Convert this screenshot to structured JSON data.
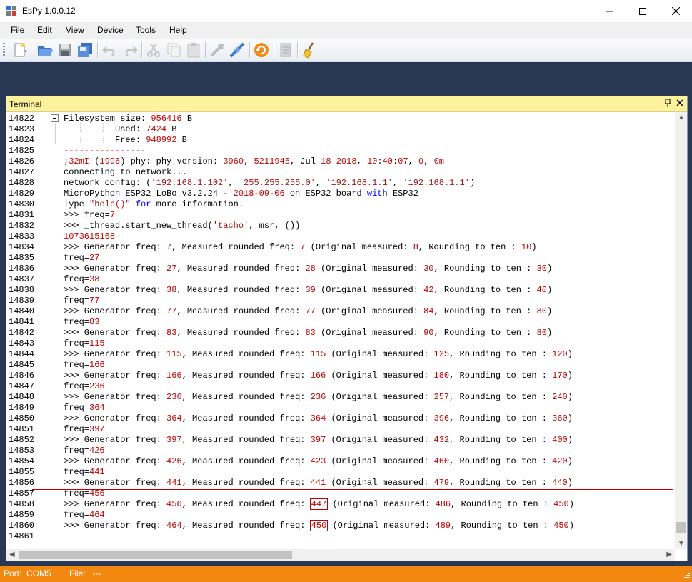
{
  "window": {
    "title": "EsPy 1.0.0.12",
    "minimize": "—",
    "maximize": "☐",
    "close": "✕"
  },
  "menu": [
    "File",
    "Edit",
    "View",
    "Device",
    "Tools",
    "Help"
  ],
  "toolbar_icons": [
    "new-file-icon",
    "open-folder-icon",
    "save-icon",
    "save-all-icon",
    "undo-icon",
    "redo-icon",
    "cut-icon",
    "copy-icon",
    "paste-icon",
    "disconnect-icon",
    "connect-icon",
    "refresh-icon",
    "document-icon",
    "broom-icon"
  ],
  "terminal": {
    "title": "Terminal",
    "pin": "📌",
    "close": "✕",
    "lines": [
      {
        "n": "14822",
        "h": "Filesystem size: <span class='n'>956416</span> B"
      },
      {
        "n": "14823",
        "h": "          Used: <span class='n'>7424</span> B"
      },
      {
        "n": "14824",
        "h": "          Free: <span class='n'>948992</span> B"
      },
      {
        "n": "14825",
        "h": "<span class='n'>----------------</span>"
      },
      {
        "n": "14826",
        "h": "<span class='n'>;32mI</span> (<span class='n'>1996</span>) phy: phy_version: <span class='n'>3960</span>, <span class='n'>5211945</span>, Jul <span class='n'>18 2018</span>, <span class='n'>10</span>:<span class='n'>40</span>:<span class='n'>07</span>, <span class='n'>0</span>, <span class='n'>0m</span>"
      },
      {
        "n": "14827",
        "h": "connecting to network..."
      },
      {
        "n": "14828",
        "h": "network config: (<span class='s'>'192.168.1.102'</span>, <span class='s'>'255.255.255.0'</span>, <span class='s'>'192.168.1.1'</span>, <span class='s'>'192.168.1.1'</span>)"
      },
      {
        "n": "14829",
        "h": "MicroPython ESP32_LoBo_v3.2.24 - <span class='n'>2018-09-06</span> on ESP32 board <span class='kw'>with</span> ESP32"
      },
      {
        "n": "14830",
        "h": "Type <span class='s'>\"help()\"</span> <span class='kw'>for</span> more information."
      },
      {
        "n": "14831",
        "h": ">>> freq=<span class='n'>7</span>"
      },
      {
        "n": "14832",
        "h": ">>> _thread.start_new_thread(<span class='s'>'tacho'</span>, msr, ())"
      },
      {
        "n": "14833",
        "h": "<span class='n'>1073615168</span>"
      },
      {
        "n": "14834",
        "h": ">>> Generator freq: <span class='n'>7</span>, Measured rounded freq: <span class='n'>7</span> (Original measured: <span class='n'>8</span>, Rounding to ten : <span class='n'>10</span>)"
      },
      {
        "n": "14835",
        "h": "freq=<span class='n'>27</span>"
      },
      {
        "n": "14836",
        "h": ">>> Generator freq: <span class='n'>27</span>, Measured rounded freq: <span class='n'>28</span> (Original measured: <span class='n'>30</span>, Rounding to ten : <span class='n'>30</span>)"
      },
      {
        "n": "14837",
        "h": "freq=<span class='n'>38</span>"
      },
      {
        "n": "14838",
        "h": ">>> Generator freq: <span class='n'>38</span>, Measured rounded freq: <span class='n'>39</span> (Original measured: <span class='n'>42</span>, Rounding to ten : <span class='n'>40</span>)"
      },
      {
        "n": "14839",
        "h": "freq=<span class='n'>77</span>"
      },
      {
        "n": "14840",
        "h": ">>> Generator freq: <span class='n'>77</span>, Measured rounded freq: <span class='n'>77</span> (Original measured: <span class='n'>84</span>, Rounding to ten : <span class='n'>80</span>)"
      },
      {
        "n": "14841",
        "h": "freq=<span class='n'>83</span>"
      },
      {
        "n": "14842",
        "h": ">>> Generator freq: <span class='n'>83</span>, Measured rounded freq: <span class='n'>83</span> (Original measured: <span class='n'>90</span>, Rounding to ten : <span class='n'>80</span>)"
      },
      {
        "n": "14843",
        "h": "freq=<span class='n'>115</span>"
      },
      {
        "n": "14844",
        "h": ">>> Generator freq: <span class='n'>115</span>, Measured rounded freq: <span class='n'>115</span> (Original measured: <span class='n'>125</span>, Rounding to ten : <span class='n'>120</span>)"
      },
      {
        "n": "14845",
        "h": "freq=<span class='n'>166</span>"
      },
      {
        "n": "14846",
        "h": ">>> Generator freq: <span class='n'>166</span>, Measured rounded freq: <span class='n'>166</span> (Original measured: <span class='n'>180</span>, Rounding to ten : <span class='n'>170</span>)"
      },
      {
        "n": "14847",
        "h": "freq=<span class='n'>236</span>"
      },
      {
        "n": "14848",
        "h": ">>> Generator freq: <span class='n'>236</span>, Measured rounded freq: <span class='n'>236</span> (Original measured: <span class='n'>257</span>, Rounding to ten : <span class='n'>240</span>)"
      },
      {
        "n": "14849",
        "h": "freq=<span class='n'>364</span>"
      },
      {
        "n": "14850",
        "h": ">>> Generator freq: <span class='n'>364</span>, Measured rounded freq: <span class='n'>364</span> (Original measured: <span class='n'>396</span>, Rounding to ten : <span class='n'>360</span>)"
      },
      {
        "n": "14851",
        "h": "freq=<span class='n'>397</span>"
      },
      {
        "n": "14852",
        "h": ">>> Generator freq: <span class='n'>397</span>, Measured rounded freq: <span class='n'>397</span> (Original measured: <span class='n'>432</span>, Rounding to ten : <span class='n'>400</span>)"
      },
      {
        "n": "14853",
        "h": "freq=<span class='n'>426</span>"
      },
      {
        "n": "14854",
        "h": ">>> Generator freq: <span class='n'>426</span>, Measured rounded freq: <span class='n'>423</span> (Original measured: <span class='n'>460</span>, Rounding to ten : <span class='n'>420</span>)"
      },
      {
        "n": "14855",
        "h": "freq=<span class='n'>441</span>"
      },
      {
        "n": "14856",
        "h": ">>> Generator freq: <span class='n'>441</span>, Measured rounded freq: <span class='n'>441</span> (Original measured: <span class='n'>479</span>, Rounding to ten : <span class='n'>440</span>)"
      },
      {
        "n": "14857",
        "h": "freq=<span class='n'>456</span>"
      },
      {
        "n": "14858",
        "h": ">>> Generator freq: <span class='n'>456</span>, Measured rounded freq: <span class='n boxed'>447</span> (Original measured: <span class='n'>486</span>, Rounding to ten : <span class='n'>450</span>)"
      },
      {
        "n": "14859",
        "h": "freq=<span class='n'>464</span>"
      },
      {
        "n": "14860",
        "h": ">>> Generator freq: <span class='n'>464</span>, Measured rounded freq: <span class='n boxed'>450</span> (Original measured: <span class='n'>489</span>, Rounding to ten : <span class='n'>450</span>)"
      },
      {
        "n": "14861",
        "h": ""
      }
    ]
  },
  "status": {
    "port_label": "Port:",
    "port": "COM5",
    "file_label": "File:",
    "file": "---"
  },
  "colors": {
    "workspace": "#293955",
    "panel_header": "#fff29d",
    "status": "#f2880f",
    "number": "#c00000",
    "string": "#a31515",
    "keyword": "#0000ff"
  }
}
